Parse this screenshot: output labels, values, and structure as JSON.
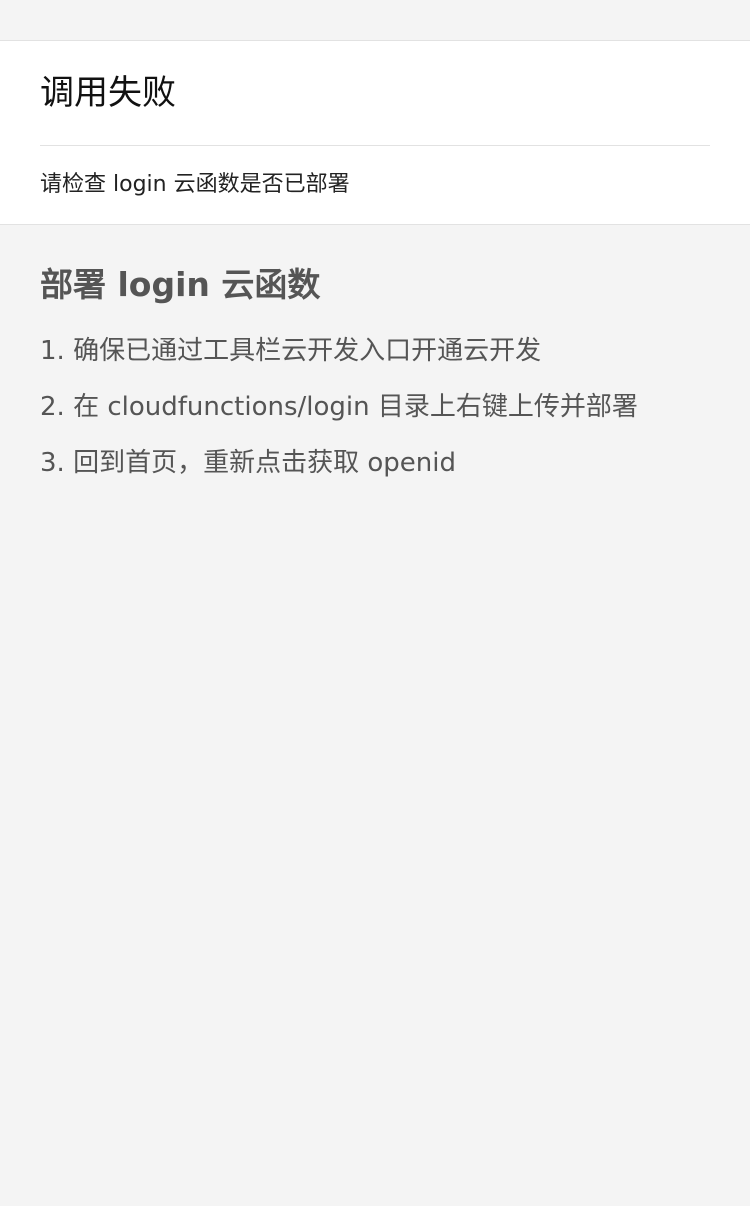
{
  "error_card": {
    "title": "调用失败",
    "description": "请检查 login 云函数是否已部署"
  },
  "guide": {
    "title": "部署 login 云函数",
    "steps": [
      "1. 确保已通过工具栏云开发入口开通云开发",
      "2. 在 cloudfunctions/login 目录上右键上传并部署",
      "3. 回到首页，重新点击获取 openid"
    ]
  }
}
